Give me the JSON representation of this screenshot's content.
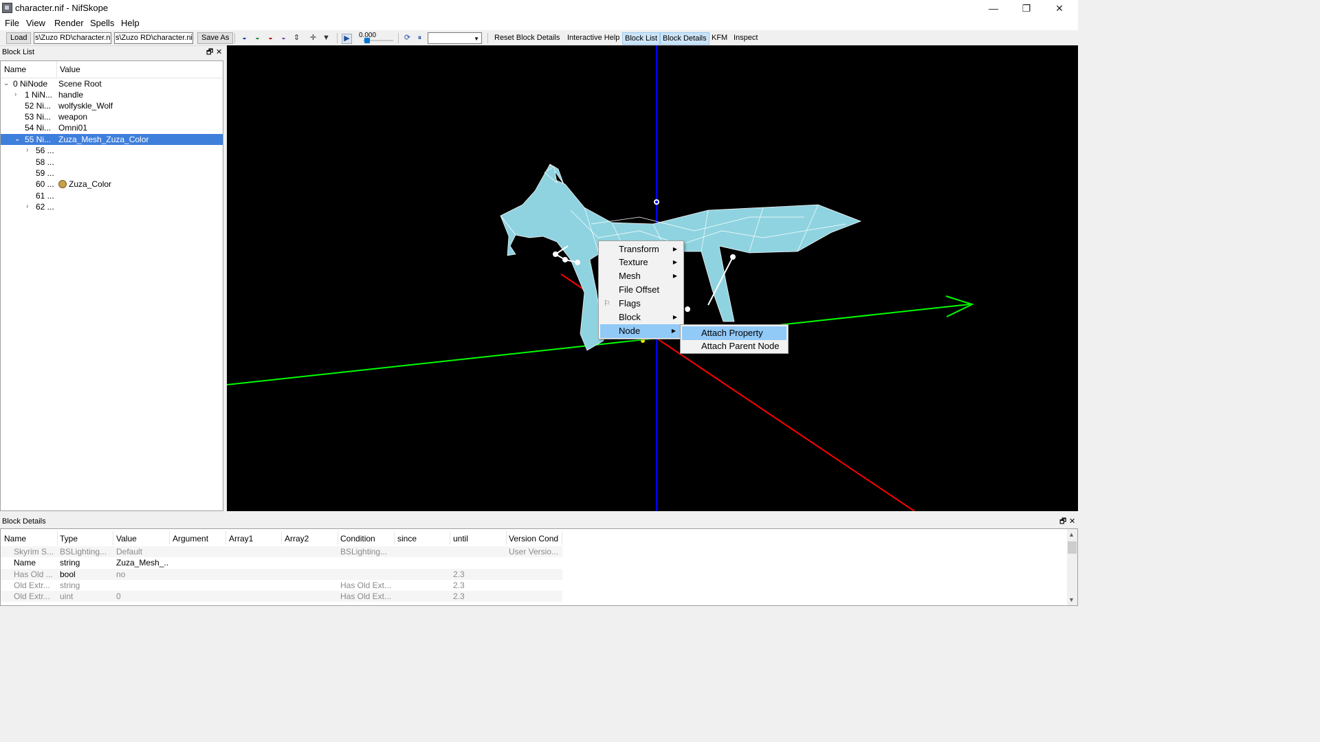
{
  "window": {
    "title": "character.nif - NifSkope",
    "minimize": "—",
    "maximize": "❐",
    "close": "✕"
  },
  "menu": [
    "File",
    "View",
    "Render",
    "Spells",
    "Help"
  ],
  "toolbar": {
    "load": "Load",
    "path1": "s\\Zuzo RD\\character.nif",
    "path2": "s\\Zuzo RD\\character.nif",
    "save_as": "Save As",
    "time": "0.000",
    "reset_block_details": "Reset Block Details",
    "interactive_help": "Interactive Help",
    "block_list": "Block List",
    "block_details": "Block Details",
    "kfm": "KFM",
    "inspect": "Inspect",
    "time_progress": 0.05
  },
  "block_list": {
    "title": "Block List",
    "columns": [
      "Name",
      "Value"
    ],
    "rows": [
      {
        "name": "0 NiNode",
        "value": "Scene Root",
        "caret": "⌄"
      },
      {
        "name": "1 NiN...",
        "value": "handle",
        "caret": "›"
      },
      {
        "name": "52 Ni...",
        "value": "wolfyskle_Wolf",
        "caret": ""
      },
      {
        "name": "53 Ni...",
        "value": "weapon",
        "caret": ""
      },
      {
        "name": "54 Ni...",
        "value": "Omni01",
        "caret": ""
      },
      {
        "name": "55 Ni...",
        "value": "Zuza_Mesh_Zuza_Color",
        "caret": "⌄"
      },
      {
        "name": "56 ...",
        "value": "",
        "caret": "›"
      },
      {
        "name": "58 ...",
        "value": "",
        "caret": ""
      },
      {
        "name": "59 ...",
        "value": "",
        "caret": ""
      },
      {
        "name": "60 ...",
        "value": "Zuza_Color",
        "caret": ""
      },
      {
        "name": "61 ...",
        "value": "",
        "caret": ""
      },
      {
        "name": "62 ...",
        "value": "",
        "caret": "›"
      }
    ]
  },
  "context_menu": {
    "items": [
      "Transform",
      "Texture",
      "Mesh",
      "File Offset",
      "Flags",
      "Block",
      "Node"
    ],
    "submenu": [
      "Attach Property",
      "Attach Parent Node"
    ]
  },
  "block_details": {
    "title": "Block Details",
    "columns": [
      "Name",
      "Type",
      "Value",
      "Argument",
      "Array1",
      "Array2",
      "Condition",
      "since",
      "until",
      "Version Cond"
    ],
    "rows": [
      [
        "Skyrim S...",
        "BSLighting...",
        "Default",
        "",
        "",
        "",
        "BSLighting...",
        "",
        "",
        "User Versio..."
      ],
      [
        "Name",
        "string",
        "Zuza_Mesh_...",
        "",
        "",
        "",
        "",
        "",
        "",
        ""
      ],
      [
        "Has Old ...",
        "bool",
        "no",
        "",
        "",
        "",
        "",
        "",
        "2.3",
        ""
      ],
      [
        "Old Extr...",
        "string",
        "",
        "",
        "",
        "",
        "Has Old Ext...",
        "",
        "2.3",
        ""
      ],
      [
        "Old Extr...",
        "uint",
        "0",
        "",
        "",
        "",
        "Has Old Ext...",
        "",
        "2.3",
        ""
      ]
    ]
  },
  "colors": {
    "selection": "#3f7fdc",
    "menu_highlight": "#91c9f7",
    "axis_x": "#ff0000",
    "axis_y": "#00ff00",
    "axis_z": "#0000ff",
    "mesh": "#8fd3e0"
  }
}
